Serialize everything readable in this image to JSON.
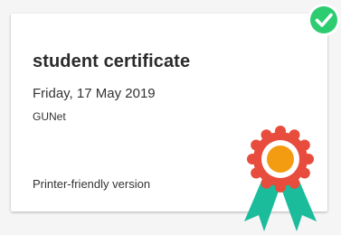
{
  "card": {
    "title": "student certificate",
    "date": "Friday, 17 May 2019",
    "issuer": "GUNet",
    "printer_link": "Printer-friendly version"
  },
  "colors": {
    "check_badge_bg": "#2ecc71",
    "ribbon_outer": "#e74c3c",
    "ribbon_center": "#f39c12",
    "ribbon_tails": "#1abc9c"
  },
  "icons": {
    "status": "check-circle-icon",
    "award": "award-ribbon-icon"
  }
}
